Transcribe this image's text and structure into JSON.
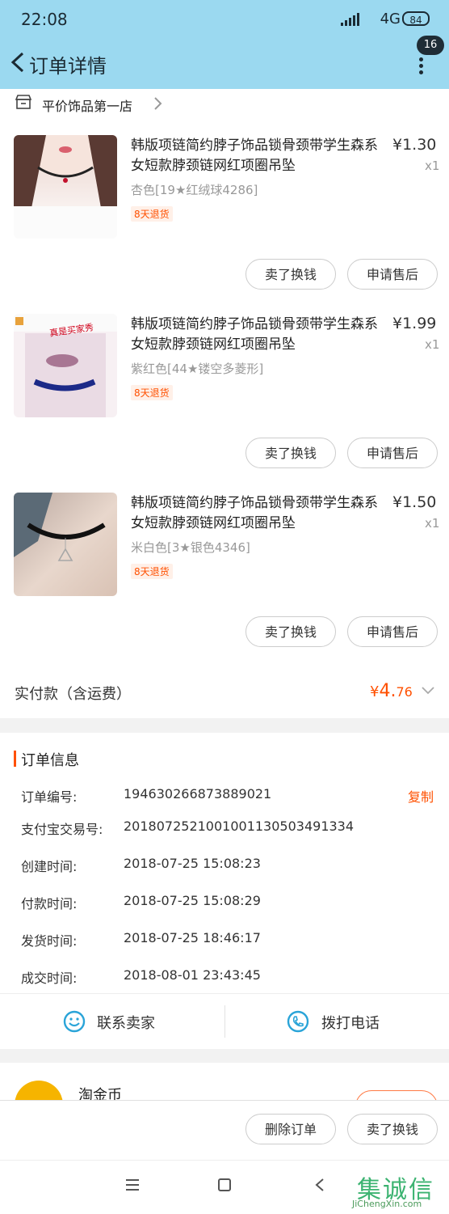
{
  "status_bar": {
    "time": "22:08",
    "network": "4G",
    "battery": "84"
  },
  "header": {
    "title": "订单详情",
    "badge": "16",
    "back_icon": "chevron-left-icon",
    "more_icon": "more-vertical-icon"
  },
  "store": {
    "name": "平价饰品第一店",
    "icon": "store-icon"
  },
  "items": [
    {
      "title": "韩版项链简约脖子饰品锁骨颈带学生森系女短款脖颈链网红项圈吊坠",
      "price": "¥1.30",
      "qty": "x1",
      "sku": "杏色[19★红绒球4286]",
      "tag": "8天退货",
      "btn_sell": "卖了换钱",
      "btn_after": "申请售后"
    },
    {
      "title": "韩版项链简约脖子饰品锁骨颈带学生森系女短款脖颈链网红项圈吊坠",
      "price": "¥1.99",
      "qty": "x1",
      "sku": "紫红色[44★镂空多菱形]",
      "tag": "8天退货",
      "btn_sell": "卖了换钱",
      "btn_after": "申请售后",
      "thumb_caption": "真是买家秀"
    },
    {
      "title": "韩版项链简约脖子饰品锁骨颈带学生森系女短款脖颈链网红项圈吊坠",
      "price": "¥1.50",
      "qty": "x1",
      "sku": "米白色[3★银色4346]",
      "tag": "8天退货",
      "btn_sell": "卖了换钱",
      "btn_after": "申请售后"
    }
  ],
  "payment": {
    "label": "实付款（含运费）",
    "currency": "¥",
    "amount_int": "4.",
    "amount_cents": "76"
  },
  "order_info": {
    "title": "订单信息",
    "copy_label": "复制",
    "rows": [
      {
        "k": "订单编号:",
        "v": "194630266873889021"
      },
      {
        "k": "支付宝交易号:",
        "v": "2018072521001001130503491334"
      },
      {
        "k": "创建时间:",
        "v": "2018-07-25 15:08:23"
      },
      {
        "k": "付款时间:",
        "v": "2018-07-25 15:08:29"
      },
      {
        "k": "发货时间:",
        "v": "2018-07-25 18:46:17"
      },
      {
        "k": "成交时间:",
        "v": "2018-08-01 23:43:45"
      }
    ]
  },
  "contact": {
    "seller": "联系卖家",
    "call": "拨打电话"
  },
  "coins": {
    "label": "淘金币"
  },
  "actions": {
    "delete": "删除订单",
    "sell": "卖了换钱"
  },
  "watermark": {
    "cn": "集诚信",
    "en": "JiChengXin.com"
  },
  "colors": {
    "header_bg": "#9bd9f0",
    "accent": "#ff5000"
  }
}
